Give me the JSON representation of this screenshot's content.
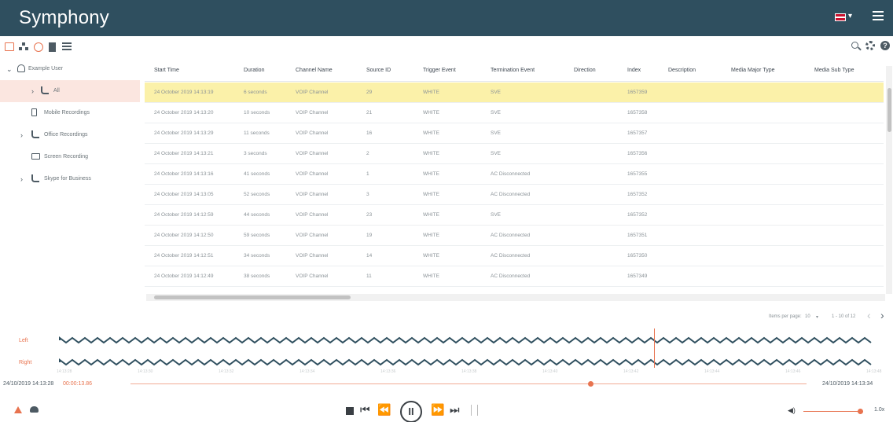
{
  "app": {
    "title": "Symphony"
  },
  "colors": {
    "header_bg": "#2f4f5f",
    "accent": "#e8734f",
    "row_highlight": "#fbf1a9",
    "selected_tree": "#fbe6e0"
  },
  "toolbar": {
    "left_icons": [
      "folder-icon",
      "org-chart-icon",
      "sync-icon",
      "document-icon",
      "list-icon"
    ],
    "right_icons": [
      "search-icon",
      "gear-icon",
      "help-icon"
    ]
  },
  "sidebar": {
    "items": [
      {
        "label": "Example User",
        "icon": "user-icon",
        "chevron": "⌄"
      },
      {
        "label": "All",
        "icon": "phone-icon",
        "chevron": "›"
      },
      {
        "label": "Mobile Recordings",
        "icon": "mobile-icon",
        "chevron": ""
      },
      {
        "label": "Office Recordings",
        "icon": "phone-icon",
        "chevron": "›"
      },
      {
        "label": "Screen Recording",
        "icon": "screen-icon",
        "chevron": ""
      },
      {
        "label": "Skype for Business",
        "icon": "phone-icon",
        "chevron": "›"
      }
    ]
  },
  "grid": {
    "columns": [
      "Start Time",
      "Duration",
      "Channel Name",
      "Source ID",
      "Trigger Event",
      "Termination Event",
      "Direction",
      "Index",
      "Description",
      "Media Major Type",
      "Media Sub Type"
    ],
    "rows": [
      [
        "24 October 2019 14:13:19",
        "6 seconds",
        "VOIP Channel",
        "29",
        "WHITE",
        "SVE",
        "",
        "1657359",
        "",
        "",
        ""
      ],
      [
        "24 October 2019 14:13:20",
        "10 seconds",
        "VOIP Channel",
        "21",
        "WHITE",
        "SVE",
        "",
        "1657358",
        "",
        "",
        ""
      ],
      [
        "24 October 2019 14:13:29",
        "11 seconds",
        "VOIP Channel",
        "16",
        "WHITE",
        "SVE",
        "",
        "1657357",
        "",
        "",
        ""
      ],
      [
        "24 October 2019 14:13:21",
        "3 seconds",
        "VOIP Channel",
        "2",
        "WHITE",
        "SVE",
        "",
        "1657356",
        "",
        "",
        ""
      ],
      [
        "24 October 2019 14:13:16",
        "41 seconds",
        "VOIP Channel",
        "1",
        "WHITE",
        "AC Disconnected",
        "",
        "1657355",
        "",
        "",
        ""
      ],
      [
        "24 October 2019 14:13:05",
        "52 seconds",
        "VOIP Channel",
        "3",
        "WHITE",
        "AC Disconnected",
        "",
        "1657352",
        "",
        "",
        ""
      ],
      [
        "24 October 2019 14:12:59",
        "44 seconds",
        "VOIP Channel",
        "23",
        "WHITE",
        "SVE",
        "",
        "1657352",
        "",
        "",
        ""
      ],
      [
        "24 October 2019 14:12:50",
        "59 seconds",
        "VOIP Channel",
        "19",
        "WHITE",
        "AC Disconnected",
        "",
        "1657351",
        "",
        "",
        ""
      ],
      [
        "24 October 2019 14:12:51",
        "34 seconds",
        "VOIP Channel",
        "14",
        "WHITE",
        "AC Disconnected",
        "",
        "1657350",
        "",
        "",
        ""
      ],
      [
        "24 October 2019 14:12:49",
        "38 seconds",
        "VOIP Channel",
        "11",
        "WHITE",
        "AC Disconnected",
        "",
        "1657349",
        "",
        "",
        ""
      ]
    ],
    "pager": {
      "items_per_page_label": "Items per page:",
      "items_per_page": "10",
      "range": "1 - 10 of 12"
    }
  },
  "waveform": {
    "channels": [
      "Left",
      "Right"
    ],
    "ticks": [
      "14:13:28",
      "14:13:30",
      "14:13:32",
      "14:13:34",
      "14:13:36",
      "14:13:38",
      "14:13:40",
      "14:13:42",
      "14:13:44",
      "14:13:46",
      "14:13:48"
    ]
  },
  "player": {
    "start_time": "24/10/2019 14:13:28",
    "current_time": "00:00:13.86",
    "end_time": "24/10/2019 14:13:34",
    "progress": 0.68,
    "volume": 0.95,
    "speed": "1.0x",
    "controls": [
      "stop",
      "skip-back",
      "rewind",
      "pause",
      "fast-forward",
      "skip-forward"
    ]
  }
}
